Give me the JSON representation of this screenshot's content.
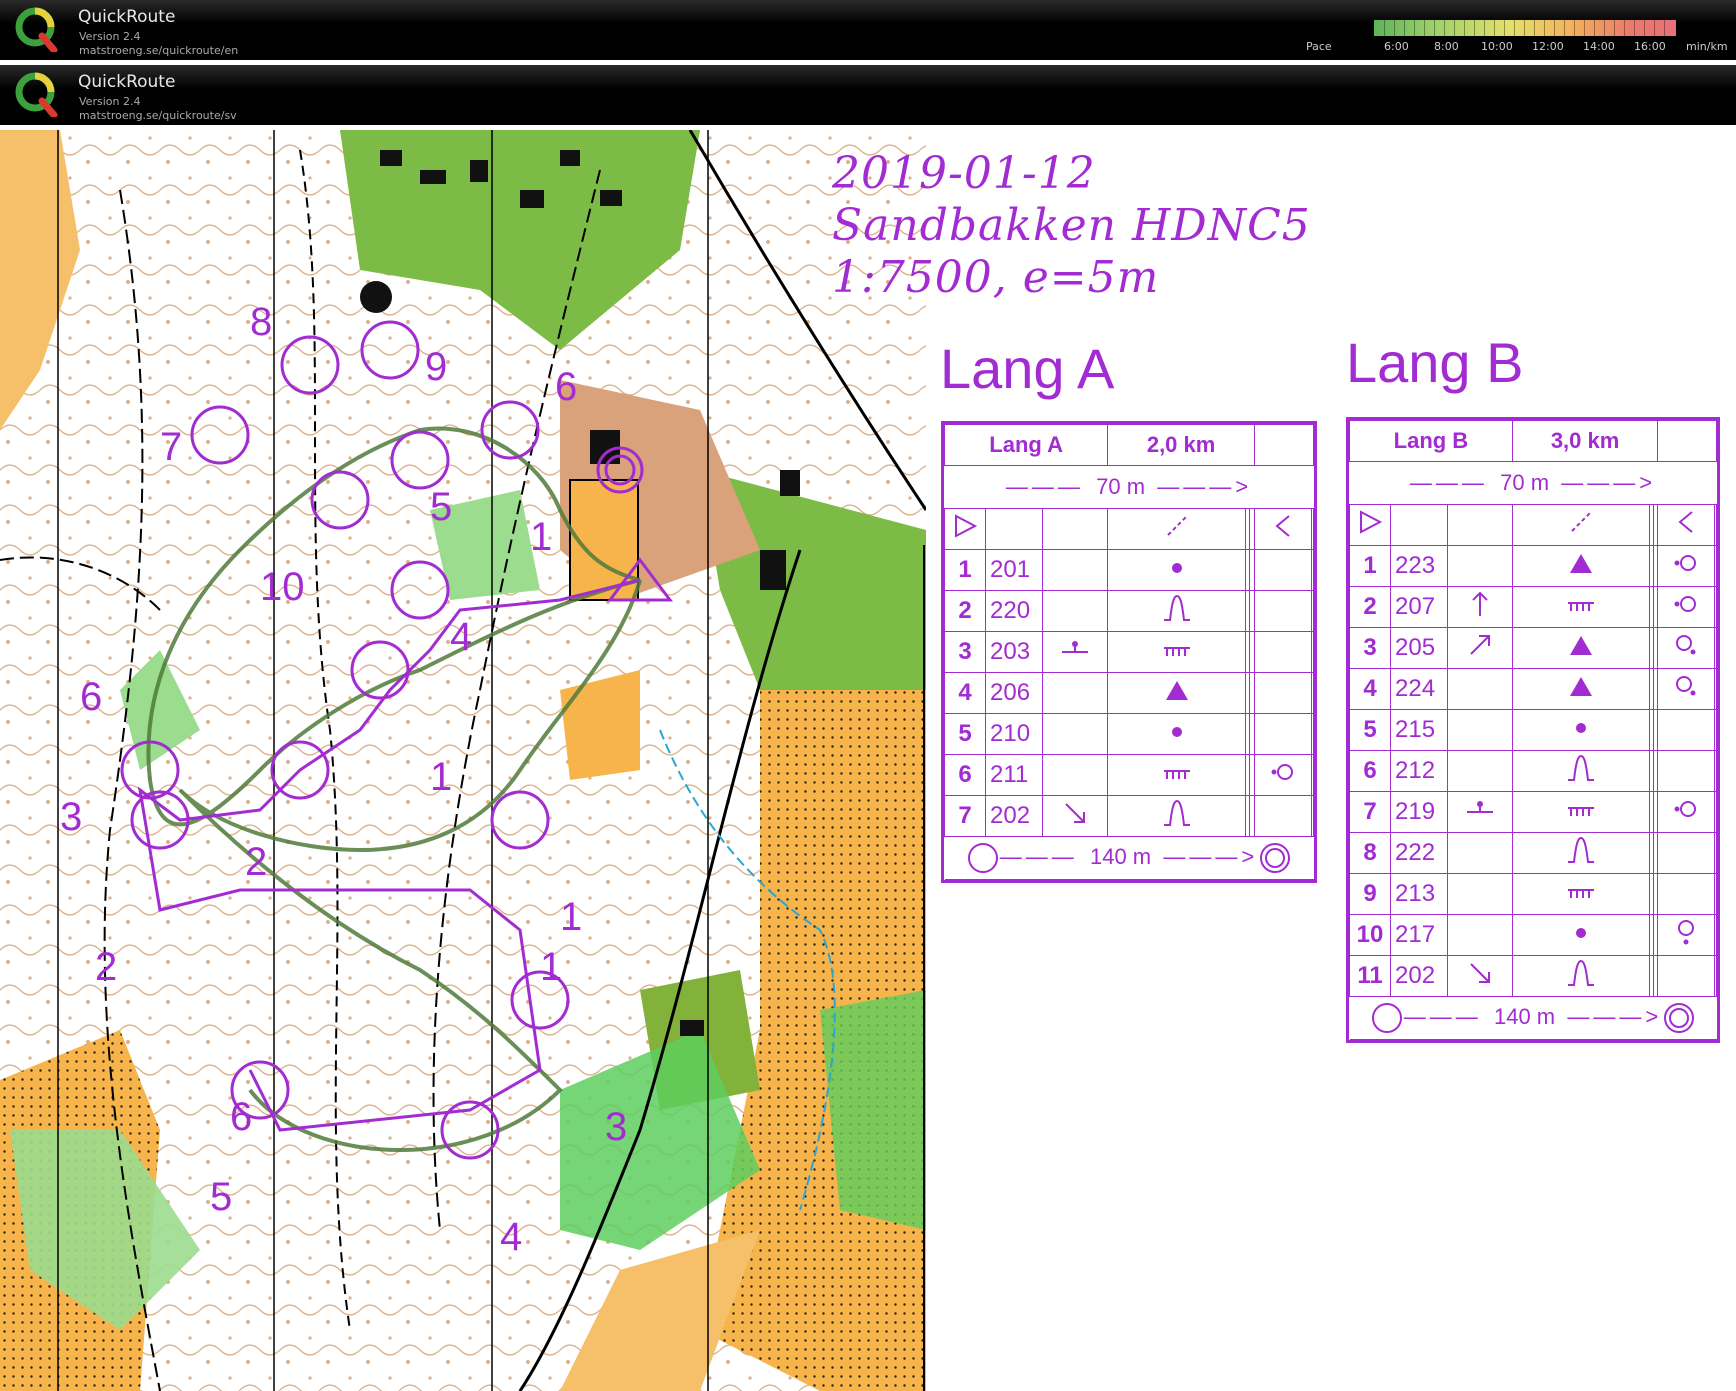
{
  "headers": [
    {
      "app": "QuickRoute",
      "version": "Version 2.4",
      "url": "matstroeng.se/quickroute/en"
    },
    {
      "app": "QuickRoute",
      "version": "Version 2.4",
      "url": "matstroeng.se/quickroute/sv"
    }
  ],
  "pace": {
    "label": "Pace",
    "ticks": [
      "6:00",
      "8:00",
      "10:00",
      "12:00",
      "14:00",
      "16:00"
    ],
    "unit": "min/km",
    "colors": [
      "#5fb35a",
      "#e5e06a",
      "#e8707a"
    ]
  },
  "map": {
    "title_lines": [
      "2019-01-12",
      "Sandbakken HDNC5",
      "1:7500, e=5m"
    ],
    "accent_color": "#a22bd1",
    "course_numbers": [
      "8",
      "9",
      "6",
      "7",
      "5",
      "1",
      "10",
      "4",
      "6",
      "3",
      "2",
      "1",
      "1",
      "1",
      "2",
      "3",
      "5",
      "4",
      "6"
    ]
  },
  "courses": [
    {
      "heading": "Lang A",
      "name": "Lang A",
      "length": "2,0 km",
      "start_dist": "70 m",
      "finish_dist": "140 m",
      "controls": [
        {
          "n": "1",
          "code": "201",
          "c": "",
          "d": "dot",
          "g": ""
        },
        {
          "n": "2",
          "code": "220",
          "c": "",
          "d": "bell",
          "g": ""
        },
        {
          "n": "3",
          "code": "203",
          "c": "bar",
          "d": "comb",
          "g": ""
        },
        {
          "n": "4",
          "code": "206",
          "c": "",
          "d": "tri",
          "g": ""
        },
        {
          "n": "5",
          "code": "210",
          "c": "",
          "d": "dot",
          "g": ""
        },
        {
          "n": "6",
          "code": "211",
          "c": "",
          "d": "comb",
          "g": "circle-side"
        },
        {
          "n": "7",
          "code": "202",
          "c": "arrow-se",
          "d": "bell",
          "g": ""
        }
      ]
    },
    {
      "heading": "Lang B",
      "name": "Lang B",
      "length": "3,0 km",
      "start_dist": "70 m",
      "finish_dist": "140 m",
      "controls": [
        {
          "n": "1",
          "code": "223",
          "c": "",
          "d": "tri",
          "g": "circle-side"
        },
        {
          "n": "2",
          "code": "207",
          "c": "arrow-n",
          "d": "comb",
          "g": "circle-side"
        },
        {
          "n": "3",
          "code": "205",
          "c": "arrow-ne",
          "d": "tri",
          "g": "circle-diag"
        },
        {
          "n": "4",
          "code": "224",
          "c": "",
          "d": "tri",
          "g": "circle-diag"
        },
        {
          "n": "5",
          "code": "215",
          "c": "",
          "d": "dot",
          "g": ""
        },
        {
          "n": "6",
          "code": "212",
          "c": "",
          "d": "bell",
          "g": ""
        },
        {
          "n": "7",
          "code": "219",
          "c": "bar",
          "d": "comb",
          "g": "circle-side"
        },
        {
          "n": "8",
          "code": "222",
          "c": "",
          "d": "bell",
          "g": ""
        },
        {
          "n": "9",
          "code": "213",
          "c": "",
          "d": "comb",
          "g": ""
        },
        {
          "n": "10",
          "code": "217",
          "c": "",
          "d": "dot",
          "g": "circle-down"
        },
        {
          "n": "11",
          "code": "202",
          "c": "arrow-se",
          "d": "bell",
          "g": ""
        }
      ]
    }
  ]
}
